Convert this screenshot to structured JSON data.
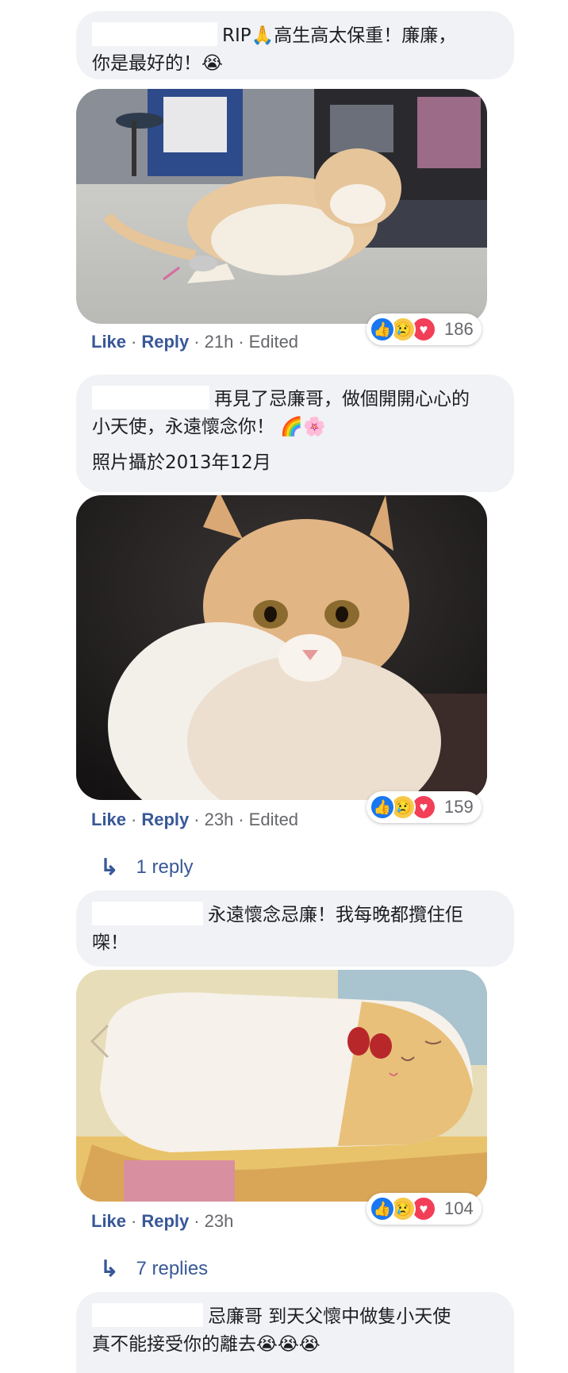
{
  "comments": [
    {
      "text_line1": "RIP🙏高生高太保重！廉廉，",
      "text_line2": "你是最好的！😭",
      "like": "Like",
      "reply": "Reply",
      "time": "21h",
      "edited": "Edited",
      "reaction_count": "186"
    },
    {
      "text_line1": "再見了忌廉哥，做個開開心心的",
      "text_line2": "小天使，永遠懷念你！ 🌈🌸",
      "text_para2": "照片攝於2013年12月",
      "like": "Like",
      "reply": "Reply",
      "time": "23h",
      "edited": "Edited",
      "reaction_count": "159",
      "replies_label": "1 reply"
    },
    {
      "text_line1": "永遠懷念忌廉！我每晚都攬住佢",
      "text_line2": "㗎！",
      "like": "Like",
      "reply": "Reply",
      "time": "23h",
      "reaction_count": "104",
      "replies_label": "7 replies"
    },
    {
      "text_line1": "忌廉哥 到天父懷中做隻小天使",
      "text_line2": "真不能接受你的離去😭😭😭"
    }
  ],
  "icons": {
    "like": "thumbs-up-icon",
    "sad": "sad-face-icon",
    "love": "heart-icon",
    "reply_arrow": "reply-arrow-icon"
  },
  "colors": {
    "link": "#385898",
    "bubble": "#f0f2f5",
    "like": "#1877f2",
    "love": "#f33e58"
  }
}
